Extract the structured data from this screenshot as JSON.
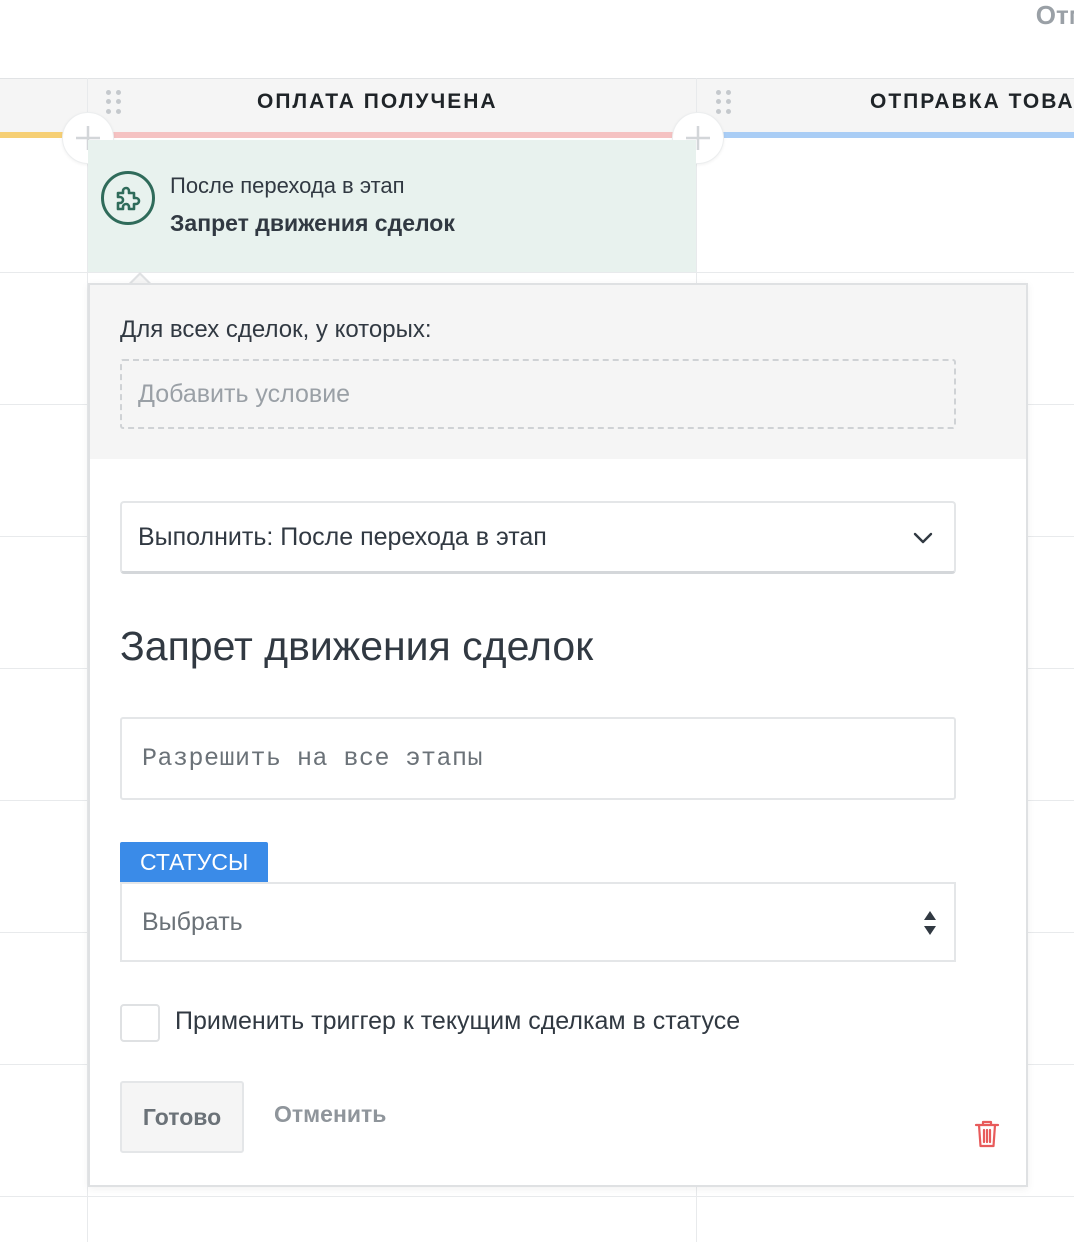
{
  "top_right": {
    "cancel_partial": "Отм"
  },
  "columns": [
    {
      "title": "ОПЛАТА ПОЛУЧЕНА",
      "color": "#f5c2c2"
    },
    {
      "title": "ОТПРАВКА ТОВА",
      "color": "#a9cdf5"
    }
  ],
  "prev_column_color": "#f6cf74",
  "trigger": {
    "subtitle": "После перехода в этап",
    "title": "Запрет движения сделок",
    "icon": "puzzle-icon"
  },
  "panel": {
    "condition_label": "Для всех сделок, у которых:",
    "add_condition_placeholder": "Добавить условие",
    "execute_select_value": "Выполнить: После перехода в этап",
    "section_title": "Запрет движения сделок",
    "allow_input_value": "Разрешить на все этапы",
    "statuses_tag": "СТАТУСЫ",
    "statuses_select_value": "Выбрать",
    "apply_checkbox_label": "Применить триггер к текущим сделкам в статусе",
    "apply_checkbox_checked": false,
    "done_button": "Готово",
    "cancel_button": "Отменить"
  },
  "colors": {
    "accent": "#3a8be8",
    "trigger_bg": "#e8f2ee",
    "trash": "#e85b5b"
  }
}
